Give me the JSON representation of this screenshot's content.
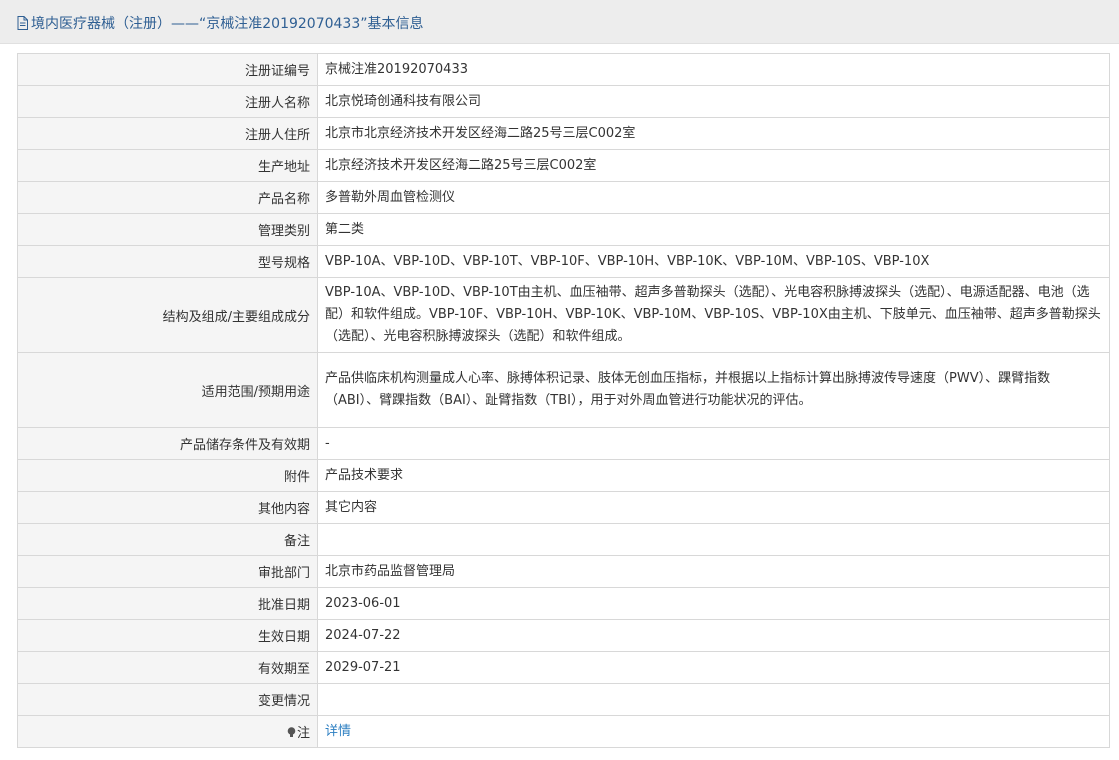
{
  "header": {
    "title": "境内医疗器械（注册）——“京械注准20192070433”基本信息"
  },
  "rows": [
    {
      "label": "注册证编号",
      "value": "京械注准20192070433"
    },
    {
      "label": "注册人名称",
      "value": "北京悦琦创通科技有限公司"
    },
    {
      "label": "注册人住所",
      "value": "北京市北京经济技术开发区经海二路25号三层C002室"
    },
    {
      "label": "生产地址",
      "value": "北京经济技术开发区经海二路25号三层C002室"
    },
    {
      "label": "产品名称",
      "value": "多普勒外周血管检测仪"
    },
    {
      "label": "管理类别",
      "value": "第二类"
    },
    {
      "label": "型号规格",
      "value": "VBP-10A、VBP-10D、VBP-10T、VBP-10F、VBP-10H、VBP-10K、VBP-10M、VBP-10S、VBP-10X"
    },
    {
      "label": "结构及组成/主要组成成分",
      "value": "VBP-10A、VBP-10D、VBP-10T由主机、血压袖带、超声多普勒探头（选配）、光电容积脉搏波探头（选配）、电源适配器、电池（选配）和软件组成。VBP-10F、VBP-10H、VBP-10K、VBP-10M、VBP-10S、VBP-10X由主机、下肢单元、血压袖带、超声多普勒探头（选配）、光电容积脉搏波探头（选配）和软件组成。"
    },
    {
      "label": "适用范围/预期用途",
      "value": "产品供临床机构测量成人心率、脉搏体积记录、肢体无创血压指标，并根据以上指标计算出脉搏波传导速度（PWV）、踝臂指数（ABI）、臂踝指数（BAI）、趾臂指数（TBI），用于对外周血管进行功能状况的评估。"
    },
    {
      "label": "产品储存条件及有效期",
      "value": "-"
    },
    {
      "label": "附件",
      "value": "产品技术要求"
    },
    {
      "label": "其他内容",
      "value": "其它内容"
    },
    {
      "label": "备注",
      "value": ""
    },
    {
      "label": "审批部门",
      "value": "北京市药品监督管理局"
    },
    {
      "label": "批准日期",
      "value": "2023-06-01"
    },
    {
      "label": "生效日期",
      "value": "2024-07-22"
    },
    {
      "label": "有效期至",
      "value": "2029-07-21"
    },
    {
      "label": "变更情况",
      "value": ""
    }
  ],
  "note_row": {
    "label": "注",
    "icon": "lightbulb-icon",
    "link_text": "详情"
  },
  "colors": {
    "header_text": "#2f5f93",
    "link": "#2d7fc2",
    "label_bg": "#f5f5f5",
    "border": "#d8d8d8"
  }
}
